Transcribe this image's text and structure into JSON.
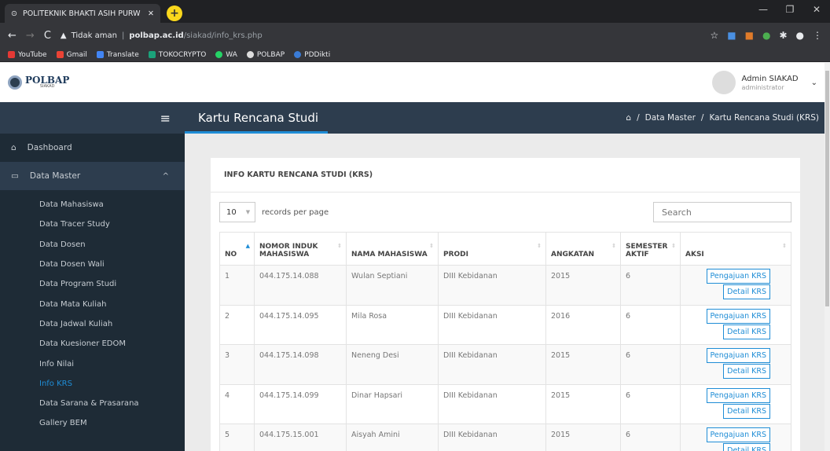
{
  "browser": {
    "tab_title": "POLITEKNIK BHAKTI ASIH PURW",
    "security": "Tidak aman",
    "host": "polbap.ac.id",
    "path": "/siakad/info_krs.php",
    "bookmarks": [
      "YouTube",
      "Gmail",
      "Translate",
      "TOKOCRYPTO",
      "WA",
      "POLBAP",
      "PDDikti"
    ]
  },
  "header": {
    "logo_text": "POLBAP",
    "logo_sub": "SIAKAD",
    "user_name": "Admin SIAKAD",
    "user_role": "administrator"
  },
  "sidebar": {
    "items": [
      {
        "label": "Dashboard"
      },
      {
        "label": "Data Master"
      }
    ],
    "subitems": [
      "Data Mahasiswa",
      "Data Tracer Study",
      "Data Dosen",
      "Data Dosen Wali",
      "Data Program Studi",
      "Data Mata Kuliah",
      "Data Jadwal Kuliah",
      "Data Kuesioner EDOM",
      "Info Nilai",
      "Info KRS",
      "Data Sarana & Prasarana",
      "Gallery BEM"
    ]
  },
  "page": {
    "title": "Kartu Rencana Studi",
    "breadcrumb": [
      "Data Master",
      "Kartu Rencana Studi (KRS)"
    ]
  },
  "card": {
    "title": "INFO KARTU RENCANA STUDI (KRS)",
    "page_size": "10",
    "records_per_page": "records per page",
    "search_placeholder": "Search"
  },
  "table": {
    "headers": [
      "NO",
      "NOMOR INDUK MAHASISWA",
      "NAMA MAHASISWA",
      "PRODI",
      "ANGKATAN",
      "SEMESTER AKTIF",
      "AKSI"
    ],
    "rows": [
      {
        "no": "1",
        "nim": "044.175.14.088",
        "nama": "Wulan Septiani",
        "prodi": "DIII Kebidanan",
        "angkatan": "2015",
        "semester": "6"
      },
      {
        "no": "2",
        "nim": "044.175.14.095",
        "nama": "Mila Rosa",
        "prodi": "DIII Kebidanan",
        "angkatan": "2016",
        "semester": "6"
      },
      {
        "no": "3",
        "nim": "044.175.14.098",
        "nama": "Neneng Desi",
        "prodi": "DIII Kebidanan",
        "angkatan": "2015",
        "semester": "6"
      },
      {
        "no": "4",
        "nim": "044.175.14.099",
        "nama": "Dinar Hapsari",
        "prodi": "DIII Kebidanan",
        "angkatan": "2015",
        "semester": "6"
      },
      {
        "no": "5",
        "nim": "044.175.15.001",
        "nama": "Aisyah Amini",
        "prodi": "DIII Kebidanan",
        "angkatan": "2015",
        "semester": "6"
      }
    ],
    "action_labels": {
      "pengajuan": "Pengajuan KRS",
      "detail": "Detail KRS"
    }
  },
  "colors": {
    "accent": "#1f8dd6",
    "sidebar_bg": "#1e2b36",
    "header_bg": "#2d3d4e"
  }
}
